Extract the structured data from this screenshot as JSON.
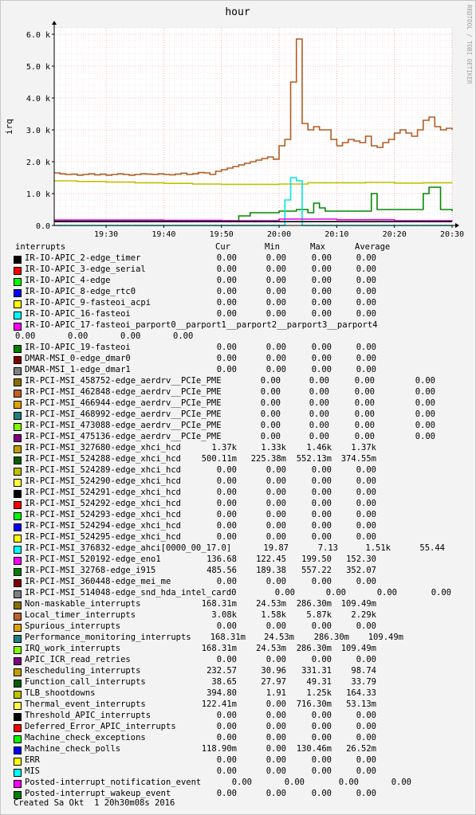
{
  "chart_data": {
    "type": "line",
    "title": "hour",
    "ylabel": "irq",
    "watermark": "RRDTOOL / TOBI OETIKER",
    "ylim": [
      0,
      6200
    ],
    "yticks": [
      0,
      1000,
      2000,
      3000,
      4000,
      5000,
      6000
    ],
    "ytick_labels": [
      "0.0",
      "1.0 k",
      "2.0 k",
      "3.0 k",
      "4.0 k",
      "5.0 k",
      "6.0 k"
    ],
    "xlim": [
      "19:21",
      "20:30"
    ],
    "xticks": [
      "19:30",
      "19:40",
      "19:50",
      "20:00",
      "20:10",
      "20:20",
      "20:30"
    ],
    "grid": true,
    "colors": {
      "brown": "#b35a1f",
      "olive": "#c0c000",
      "green": "#008a00",
      "cyan": "#00e5e5",
      "magenta": "#e000e0",
      "black": "#000000",
      "purple": "#800080"
    },
    "series": [
      {
        "name": "Local_timer_interrupts",
        "color": "#b35a1f",
        "x": [
          "19:21",
          "19:22",
          "19:23",
          "19:24",
          "19:25",
          "19:26",
          "19:27",
          "19:28",
          "19:29",
          "19:30",
          "19:31",
          "19:32",
          "19:33",
          "19:34",
          "19:35",
          "19:36",
          "19:37",
          "19:38",
          "19:39",
          "19:40",
          "19:41",
          "19:42",
          "19:43",
          "19:44",
          "19:45",
          "19:46",
          "19:47",
          "19:48",
          "19:49",
          "19:50",
          "19:51",
          "19:52",
          "19:53",
          "19:54",
          "19:55",
          "19:56",
          "19:57",
          "19:58",
          "19:59",
          "20:00",
          "20:01",
          "20:02",
          "20:03",
          "20:04",
          "20:05",
          "20:06",
          "20:07",
          "20:08",
          "20:09",
          "20:10",
          "20:11",
          "20:12",
          "20:13",
          "20:14",
          "20:15",
          "20:16",
          "20:17",
          "20:18",
          "20:19",
          "20:20",
          "20:21",
          "20:22",
          "20:23",
          "20:24",
          "20:25",
          "20:26",
          "20:27",
          "20:28",
          "20:29",
          "20:30"
        ],
        "y": [
          1650,
          1620,
          1600,
          1610,
          1580,
          1600,
          1620,
          1590,
          1610,
          1580,
          1600,
          1620,
          1600,
          1580,
          1600,
          1620,
          1610,
          1600,
          1620,
          1600,
          1590,
          1610,
          1640,
          1600,
          1620,
          1660,
          1650,
          1600,
          1700,
          1750,
          1800,
          1850,
          1900,
          1950,
          2000,
          2050,
          2100,
          2150,
          2080,
          2500,
          2700,
          4500,
          5850,
          3200,
          3000,
          3100,
          3000,
          3000,
          2700,
          2500,
          2600,
          2700,
          2650,
          2600,
          2800,
          2500,
          2450,
          2600,
          2700,
          2900,
          3000,
          2900,
          2800,
          3000,
          3300,
          3400,
          3100,
          3000,
          3050,
          3000
        ]
      },
      {
        "name": "Rescheduling_interrupts",
        "color": "#c0c000",
        "x": [
          "19:21",
          "19:25",
          "19:30",
          "19:35",
          "19:40",
          "19:45",
          "19:50",
          "19:55",
          "20:00",
          "20:05",
          "20:10",
          "20:15",
          "20:20",
          "20:25",
          "20:30"
        ],
        "y": [
          1400,
          1380,
          1360,
          1340,
          1320,
          1300,
          1290,
          1290,
          1300,
          1340,
          1340,
          1350,
          1330,
          1340,
          1330
        ]
      },
      {
        "name": "IRQ_work_interrupts",
        "color": "#008a00",
        "x": [
          "19:21",
          "19:45",
          "19:50",
          "19:53",
          "19:55",
          "20:00",
          "20:03",
          "20:05",
          "20:06",
          "20:07",
          "20:08",
          "20:10",
          "20:15",
          "20:16",
          "20:17",
          "20:18",
          "20:20",
          "20:24",
          "20:25",
          "20:26",
          "20:28",
          "20:30"
        ],
        "y": [
          150,
          150,
          150,
          300,
          400,
          450,
          500,
          400,
          700,
          550,
          450,
          450,
          450,
          1000,
          500,
          500,
          500,
          500,
          1000,
          1200,
          500,
          450
        ]
      },
      {
        "name": "IR-PCI-MSI_376832-edge_ahci[0000_00_17.0]",
        "color": "#00e5e5",
        "x": [
          "19:21",
          "20:00",
          "20:01",
          "20:02",
          "20:03",
          "20:04",
          "20:30"
        ],
        "y": [
          0,
          0,
          800,
          1500,
          1400,
          0,
          0
        ]
      },
      {
        "name": "IR-PCI-MSI_520192-edge_eno1",
        "color": "#e000e0",
        "x": [
          "19:21",
          "19:40",
          "19:50",
          "20:00",
          "20:10",
          "20:20",
          "20:30"
        ],
        "y": [
          170,
          160,
          150,
          200,
          180,
          150,
          160
        ]
      },
      {
        "name": "IR-IO-APIC_2-edge_timer",
        "color": "#000000",
        "x": [
          "19:21",
          "20:30"
        ],
        "y": [
          120,
          120
        ]
      }
    ]
  },
  "legend": {
    "headers": [
      "interrupts",
      "Cur",
      "Min",
      "Max",
      "Average"
    ],
    "rows": [
      {
        "name": "IR-IO-APIC_2-edge_timer",
        "color": "#000000",
        "vals": [
          "0.00",
          "0.00",
          "0.00",
          "0.00"
        ],
        "col": "a"
      },
      {
        "name": "IR-IO-APIC_3-edge_serial",
        "color": "#ff0000",
        "vals": [
          "0.00",
          "0.00",
          "0.00",
          "0.00"
        ],
        "col": "a"
      },
      {
        "name": "IR-IO-APIC_4-edge",
        "color": "#00ff00",
        "vals": [
          "0.00",
          "0.00",
          "0.00",
          "0.00"
        ],
        "col": "a"
      },
      {
        "name": "IR-IO-APIC_8-edge_rtc0",
        "color": "#0000ff",
        "vals": [
          "0.00",
          "0.00",
          "0.00",
          "0.00"
        ],
        "col": "a"
      },
      {
        "name": "IR-IO-APIC_9-fasteoi_acpi",
        "color": "#ffff00",
        "vals": [
          "0.00",
          "0.00",
          "0.00",
          "0.00"
        ],
        "col": "a"
      },
      {
        "name": "IR-IO-APIC_16-fasteoi",
        "color": "#00ffff",
        "vals": [
          "0.00",
          "0.00",
          "0.00",
          "0.00"
        ],
        "col": "a"
      },
      {
        "name": "IR-IO-APIC_17-fasteoi_parport0__parport1__parport2__parport3__parport4",
        "color": "#ff00ff",
        "vals": [
          "0.00",
          "0.00",
          "0.00",
          "0.00"
        ],
        "col": "wrap"
      },
      {
        "name": "IR-IO-APIC_19-fasteoi",
        "color": "#008000",
        "vals": [
          "0.00",
          "0.00",
          "0.00",
          "0.00"
        ],
        "col": "a"
      },
      {
        "name": "DMAR-MSI_0-edge_dmar0",
        "color": "#800000",
        "vals": [
          "0.00",
          "0.00",
          "0.00",
          "0.00"
        ],
        "col": "a"
      },
      {
        "name": "DMAR-MSI_1-edge_dmar1",
        "color": "#808080",
        "vals": [
          "0.00",
          "0.00",
          "0.00",
          "0.00"
        ],
        "col": "a"
      },
      {
        "name": "IR-PCI-MSI_458752-edge_aerdrv__PCIe_PME",
        "color": "#8c6e00",
        "vals": [
          "0.00",
          "0.00",
          "0.00",
          "0.00"
        ],
        "col": "b"
      },
      {
        "name": "IR-PCI-MSI_462848-edge_aerdrv__PCIe_PME",
        "color": "#c0602a",
        "vals": [
          "0.00",
          "0.00",
          "0.00",
          "0.00"
        ],
        "col": "b"
      },
      {
        "name": "IR-PCI-MSI_466944-edge_aerdrv__PCIe_PME",
        "color": "#e0a000",
        "vals": [
          "0.00",
          "0.00",
          "0.00",
          "0.00"
        ],
        "col": "b"
      },
      {
        "name": "IR-PCI-MSI_468992-edge_aerdrv__PCIe_PME",
        "color": "#208080",
        "vals": [
          "0.00",
          "0.00",
          "0.00",
          "0.00"
        ],
        "col": "b"
      },
      {
        "name": "IR-PCI-MSI_473088-edge_aerdrv__PCIe_PME",
        "color": "#80ff00",
        "vals": [
          "0.00",
          "0.00",
          "0.00",
          "0.00"
        ],
        "col": "b"
      },
      {
        "name": "IR-PCI-MSI_475136-edge_aerdrv__PCIe_PME",
        "color": "#800080",
        "vals": [
          "0.00",
          "0.00",
          "0.00",
          "0.00"
        ],
        "col": "b"
      },
      {
        "name": "IR-PCI-MSI_327680-edge_xhci_hcd",
        "color": "#c0a000",
        "vals": [
          "1.37k",
          "1.33k",
          "1.46k",
          "1.37k"
        ],
        "col": "a"
      },
      {
        "name": "IR-PCI-MSI_524288-edge_xhci_hcd",
        "color": "#006000",
        "vals": [
          "500.11m",
          "225.38m",
          "552.13m",
          "374.55m"
        ],
        "col": "a"
      },
      {
        "name": "IR-PCI-MSI_524289-edge_xhci_hcd",
        "color": "#c0c000",
        "vals": [
          "0.00",
          "0.00",
          "0.00",
          "0.00"
        ],
        "col": "a"
      },
      {
        "name": "IR-PCI-MSI_524290-edge_xhci_hcd",
        "color": "#ffff40",
        "vals": [
          "0.00",
          "0.00",
          "0.00",
          "0.00"
        ],
        "col": "a"
      },
      {
        "name": "IR-PCI-MSI_524291-edge_xhci_hcd",
        "color": "#000000",
        "vals": [
          "0.00",
          "0.00",
          "0.00",
          "0.00"
        ],
        "col": "a"
      },
      {
        "name": "IR-PCI-MSI_524292-edge_xhci_hcd",
        "color": "#ff0000",
        "vals": [
          "0.00",
          "0.00",
          "0.00",
          "0.00"
        ],
        "col": "a"
      },
      {
        "name": "IR-PCI-MSI_524293-edge_xhci_hcd",
        "color": "#00ff00",
        "vals": [
          "0.00",
          "0.00",
          "0.00",
          "0.00"
        ],
        "col": "a"
      },
      {
        "name": "IR-PCI-MSI_524294-edge_xhci_hcd",
        "color": "#0000ff",
        "vals": [
          "0.00",
          "0.00",
          "0.00",
          "0.00"
        ],
        "col": "a"
      },
      {
        "name": "IR-PCI-MSI_524295-edge_xhci_hcd",
        "color": "#ffff00",
        "vals": [
          "0.00",
          "0.00",
          "0.00",
          "0.00"
        ],
        "col": "a"
      },
      {
        "name": "IR-PCI-MSI_376832-edge_ahci[0000_00_17.0]",
        "color": "#00ffff",
        "vals": [
          "19.87",
          "7.13",
          "1.51k",
          "55.44"
        ],
        "col": "c"
      },
      {
        "name": "IR-PCI-MSI_520192-edge_eno1",
        "color": "#ff00ff",
        "vals": [
          "136.68",
          "122.45",
          "199.50",
          "152.30"
        ],
        "col": "a"
      },
      {
        "name": "IR-PCI-MSI_32768-edge_i915",
        "color": "#008000",
        "vals": [
          "485.56",
          "189.38",
          "557.22",
          "352.07"
        ],
        "col": "a"
      },
      {
        "name": "IR-PCI-MSI_360448-edge_mei_me",
        "color": "#800000",
        "vals": [
          "0.00",
          "0.00",
          "0.00",
          "0.00"
        ],
        "col": "a"
      },
      {
        "name": "IR-PCI-MSI_514048-edge_snd_hda_intel_card0",
        "color": "#808080",
        "vals": [
          "0.00",
          "0.00",
          "0.00",
          "0.00"
        ],
        "col": "d"
      },
      {
        "name": "Non-maskable_interrupts",
        "color": "#8c6e00",
        "vals": [
          "168.31m",
          "24.53m",
          "286.30m",
          "109.49m"
        ],
        "col": "a"
      },
      {
        "name": "Local_timer_interrupts",
        "color": "#c0602a",
        "vals": [
          "3.08k",
          "1.58k",
          "5.87k",
          "2.29k"
        ],
        "col": "a"
      },
      {
        "name": "Spurious_interrupts",
        "color": "#e0a000",
        "vals": [
          "0.00",
          "0.00",
          "0.00",
          "0.00"
        ],
        "col": "a"
      },
      {
        "name": "Performance_monitoring_interrupts",
        "color": "#208080",
        "vals": [
          "168.31m",
          "24.53m",
          "286.30m",
          "109.49m"
        ],
        "col": "e"
      },
      {
        "name": "IRQ_work_interrupts",
        "color": "#80ff00",
        "vals": [
          "168.31m",
          "24.53m",
          "286.30m",
          "109.49m"
        ],
        "col": "a"
      },
      {
        "name": "APIC_ICR_read_retries",
        "color": "#800080",
        "vals": [
          "0.00",
          "0.00",
          "0.00",
          "0.00"
        ],
        "col": "a"
      },
      {
        "name": "Rescheduling_interrupts",
        "color": "#c0a000",
        "vals": [
          "232.57",
          "30.96",
          "331.31",
          "98.74"
        ],
        "col": "a"
      },
      {
        "name": "Function_call_interrupts",
        "color": "#006000",
        "vals": [
          "38.65",
          "27.97",
          "49.31",
          "33.79"
        ],
        "col": "a"
      },
      {
        "name": "TLB_shootdowns",
        "color": "#c0c000",
        "vals": [
          "394.80",
          "1.91",
          "1.25k",
          "164.33"
        ],
        "col": "a"
      },
      {
        "name": "Thermal_event_interrupts",
        "color": "#ffff40",
        "vals": [
          "122.41m",
          "0.00",
          "716.30m",
          "53.13m"
        ],
        "col": "a"
      },
      {
        "name": "Threshold_APIC_interrupts",
        "color": "#000000",
        "vals": [
          "0.00",
          "0.00",
          "0.00",
          "0.00"
        ],
        "col": "a"
      },
      {
        "name": "Deferred_Error_APIC_interrupts",
        "color": "#ff0000",
        "vals": [
          "0.00",
          "0.00",
          "0.00",
          "0.00"
        ],
        "col": "a"
      },
      {
        "name": "Machine_check_exceptions",
        "color": "#00ff00",
        "vals": [
          "0.00",
          "0.00",
          "0.00",
          "0.00"
        ],
        "col": "a"
      },
      {
        "name": "Machine_check_polls",
        "color": "#0000ff",
        "vals": [
          "118.90m",
          "0.00",
          "130.46m",
          "26.52m"
        ],
        "col": "a"
      },
      {
        "name": "ERR",
        "color": "#ffff00",
        "vals": [
          "0.00",
          "0.00",
          "0.00",
          "0.00"
        ],
        "col": "a"
      },
      {
        "name": "MIS",
        "color": "#00ffff",
        "vals": [
          "0.00",
          "0.00",
          "0.00",
          "0.00"
        ],
        "col": "a"
      },
      {
        "name": "Posted-interrupt_notification_event",
        "color": "#ff00ff",
        "vals": [
          "0.00",
          "0.00",
          "0.00",
          "0.00"
        ],
        "col": "f"
      },
      {
        "name": "Posted-interrupt_wakeup_event",
        "color": "#008000",
        "vals": [
          "0.00",
          "0.00",
          "0.00",
          "0.00"
        ],
        "col": "a"
      }
    ],
    "footer": "Created Sa Okt  1 20h30m08s 2016"
  }
}
